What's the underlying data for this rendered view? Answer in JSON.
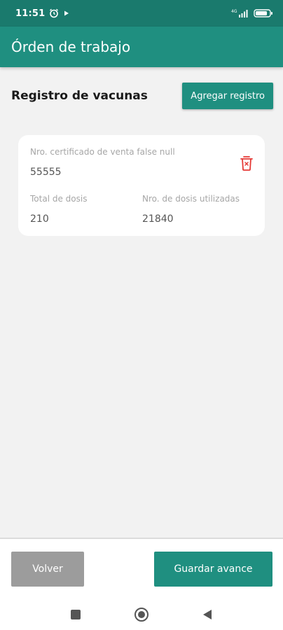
{
  "status_bar": {
    "time": "11:51",
    "network": "4G",
    "battery": "80",
    "icons": [
      "alarm-icon",
      "play-icon",
      "signal-icon",
      "battery-icon"
    ]
  },
  "app_bar": {
    "title": "Órden de trabajo"
  },
  "section": {
    "title": "Registro de vacunas",
    "add_button": "Agregar registro"
  },
  "record": {
    "certificate_label": "Nro. certificado de venta false null",
    "certificate_value": "55555",
    "total_doses_label": "Total de dosis",
    "total_doses_value": "210",
    "used_doses_label": "Nro. de dosis utilizadas",
    "used_doses_value": "21840",
    "delete_icon": "trash-icon"
  },
  "footer": {
    "back_button": "Volver",
    "save_button": "Guardar avance"
  },
  "colors": {
    "primary": "#1f8f80",
    "status_bar": "#1a7a6d",
    "delete": "#e53935",
    "disabled": "#9c9c9c"
  }
}
